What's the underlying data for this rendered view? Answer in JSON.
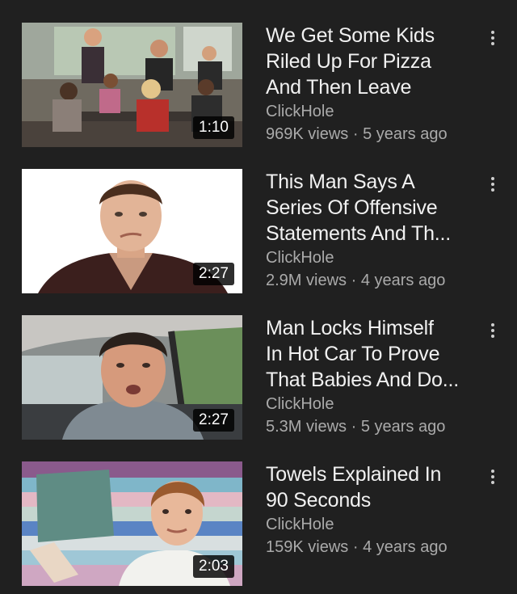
{
  "videos": [
    {
      "title_lines": [
        "We Get Some Kids",
        "Riled Up For Pizza",
        "And Then Leave"
      ],
      "channel": "ClickHole",
      "views": "969K views",
      "age": "5 years ago",
      "duration": "1:10",
      "thumbnail": "kids-classroom-thumbnail"
    },
    {
      "title_lines": [
        "This Man Says A",
        "Series Of Offensive",
        "Statements And Th..."
      ],
      "channel": "ClickHole",
      "views": "2.9M views",
      "age": "4 years ago",
      "duration": "2:27",
      "thumbnail": "man-portrait-thumbnail"
    },
    {
      "title_lines": [
        "Man Locks Himself",
        "In Hot Car To Prove",
        "That Babies And Do..."
      ],
      "channel": "ClickHole",
      "views": "5.3M views",
      "age": "5 years ago",
      "duration": "2:27",
      "thumbnail": "man-in-car-thumbnail"
    },
    {
      "title_lines": [
        "Towels Explained In",
        "90 Seconds"
      ],
      "channel": "ClickHole",
      "views": "159K views",
      "age": "4 years ago",
      "duration": "2:03",
      "thumbnail": "towels-thumbnail"
    }
  ],
  "separator": " · ",
  "more_icon": "more-vert-icon",
  "colors": {
    "background": "#202020",
    "title": "#f1f1f1",
    "secondary": "#aaaaaa"
  }
}
